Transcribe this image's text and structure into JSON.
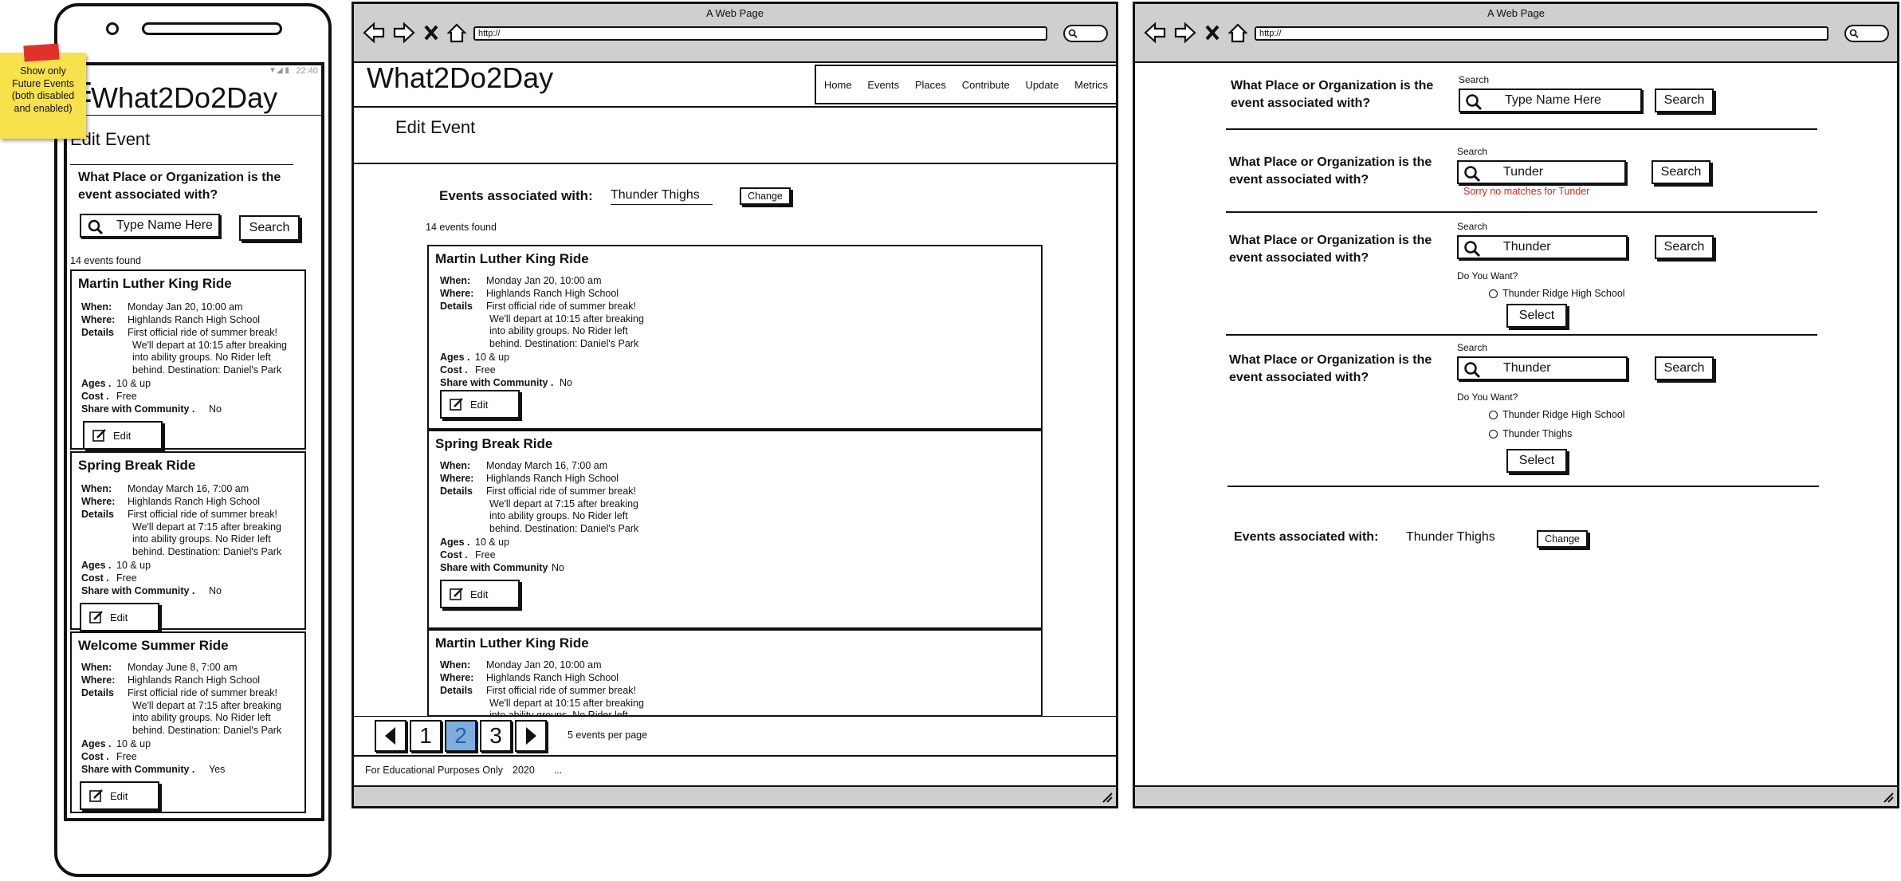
{
  "note": {
    "text": "Show only Future Events (both disabled and enabled)"
  },
  "mobile": {
    "status_time": "22:40",
    "app_title": "What2Do2Day",
    "page_title": "Edit Event",
    "question": "What Place or Organization is the event associated with?",
    "search_placeholder": "Type Name Here",
    "search_button": "Search",
    "events_found": "14 events found"
  },
  "labels": {
    "when": "When:",
    "where": "Where:",
    "details": "Details",
    "ages": "Ages .",
    "cost": "Cost .",
    "share": "Share with Community .",
    "share_nodot": "Share with Community",
    "edit": "Edit"
  },
  "events": [
    {
      "title": "Martin Luther King Ride",
      "when": "Monday Jan 20, 10:00 am",
      "where": "Highlands Ranch High School",
      "details": [
        "First official ride of summer break!",
        "We'll depart at 10:15 after breaking",
        "into ability groups. No Rider left",
        "behind.  Destination: Daniel's Park"
      ],
      "ages": "10 & up",
      "cost": "Free",
      "share": "No"
    },
    {
      "title": "Spring Break Ride",
      "when": "Monday March 16, 7:00 am",
      "where": "Highlands Ranch High School",
      "details": [
        "First official ride of summer break!",
        "We'll depart at 7:15 after breaking",
        "into ability groups. No Rider left",
        "behind.   Destination: Daniel's Park"
      ],
      "ages": "10 & up",
      "cost": "Free",
      "share": "No"
    },
    {
      "title": "Welcome Summer Ride",
      "when": "Monday June 8, 7:00 am",
      "where": "Highlands Ranch High School",
      "details": [
        "First official ride of summer break!",
        "We'll depart at 7:15 after breaking",
        "into ability groups. No Rider left",
        "behind.   Destination: Daniel's Park"
      ],
      "ages": "10 & up",
      "cost": "Free",
      "share": "Yes"
    }
  ],
  "browser": {
    "window_title": "A Web Page",
    "url": "http://"
  },
  "desktop": {
    "site_title": "What2Do2Day",
    "nav": [
      "Home",
      "Events",
      "Places",
      "Contribute",
      "Update",
      "Metrics"
    ],
    "page_title": "Edit Event",
    "assoc_label": "Events associated with:",
    "assoc_value": "Thunder Thighs",
    "change_button": "Change",
    "events_found": "14 events found",
    "pagination": {
      "pages": [
        "1",
        "2",
        "3"
      ],
      "current": "2",
      "per_page": "5 events per page"
    },
    "footer_text": "For Educational Purposes Only",
    "footer_year": "2020",
    "footer_more": "..."
  },
  "states": {
    "question": "What Place or Organization is the event associated with?",
    "search_label": "Search",
    "search_button": "Search",
    "state1": {
      "placeholder": "Type Name Here"
    },
    "state2": {
      "value": "Tunder",
      "error": "Sorry no matches for Tunder"
    },
    "state3": {
      "value": "Thunder",
      "prompt": "Do You Want?",
      "options": [
        "Thunder Ridge High School"
      ],
      "select": "Select"
    },
    "state4": {
      "value": "Thunder",
      "prompt": "Do You Want?",
      "options": [
        "Thunder Ridge High School",
        "Thunder Thighs"
      ],
      "select": "Select"
    },
    "assoc_label": "Events associated with:",
    "assoc_value": "Thunder Thighs",
    "change_button": "Change"
  },
  "colors": {
    "note": "#f7e24d",
    "note_pin": "#e0322b",
    "page_active": "#7eaee0",
    "error": "#d4271c",
    "chrome": "#cfcfcf"
  }
}
